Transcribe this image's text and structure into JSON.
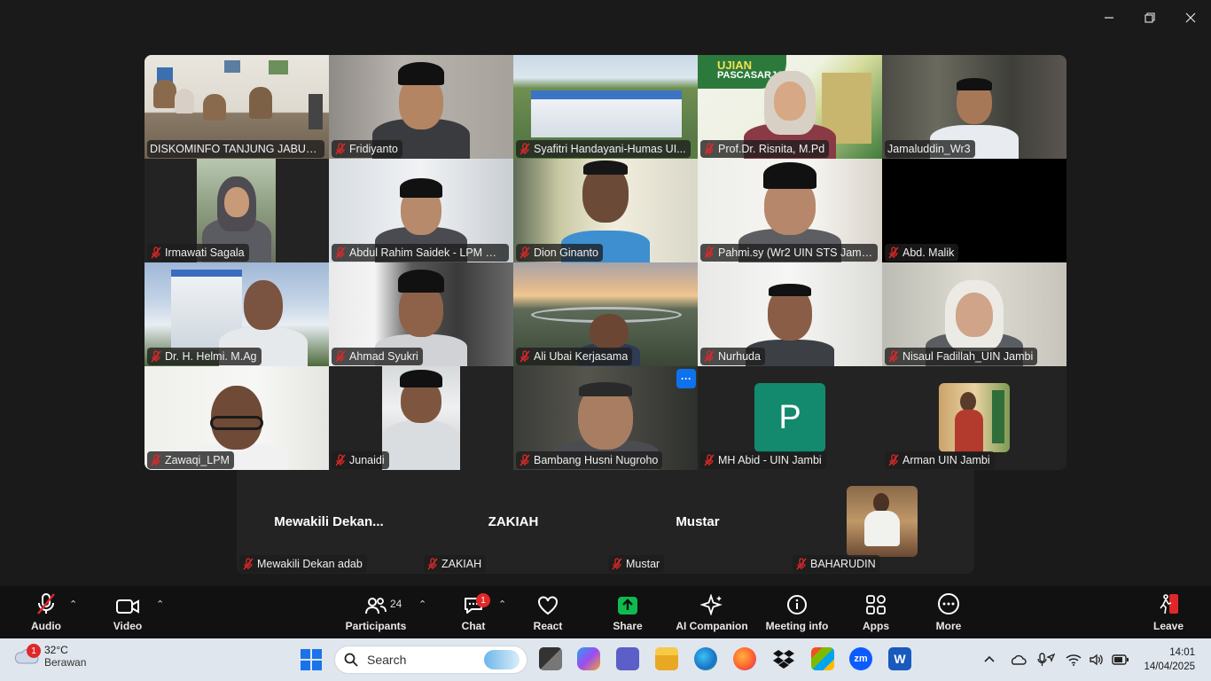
{
  "gallery": [
    {
      "name": "DISKOMINFO TANJUNG JABUNG...",
      "muted": false,
      "active": true
    },
    {
      "name": "Fridiyanto",
      "muted": true
    },
    {
      "name": "Syafitri Handayani-Humas UI...",
      "muted": true
    },
    {
      "name": "Prof.Dr. Risnita, M.Pd",
      "muted": true
    },
    {
      "name": "Jamaluddin_Wr3",
      "muted": false
    },
    {
      "name": "Irmawati Sagala",
      "muted": true
    },
    {
      "name": "Abdul  Rahim Saidek - LPM UI...",
      "muted": true
    },
    {
      "name": "Dion Ginanto",
      "muted": true
    },
    {
      "name": "Pahmi.sy (Wr2 UIN STS Jambi)",
      "muted": true
    },
    {
      "name": "Abd. Malik",
      "muted": true
    },
    {
      "name": "Dr. H. Helmi. M.Ag",
      "muted": true
    },
    {
      "name": "Ahmad Syukri",
      "muted": true
    },
    {
      "name": "Ali Ubai Kerjasama",
      "muted": true
    },
    {
      "name": "Nurhuda",
      "muted": true
    },
    {
      "name": "Nisaul Fadillah_UIN Jambi",
      "muted": true
    },
    {
      "name": "Zawaqi_LPM",
      "muted": true
    },
    {
      "name": "Junaidi",
      "muted": true
    },
    {
      "name": "Bambang Husni Nugroho",
      "muted": true
    },
    {
      "name": "MH Abid - UIN Jambi",
      "muted": true,
      "avatar_letter": "P"
    },
    {
      "name": "Arman UIN Jambi",
      "muted": true
    }
  ],
  "strip": [
    {
      "display": "Mewakili  Dekan...",
      "name": "Mewakili Dekan adab"
    },
    {
      "display": "ZAKIAH",
      "name": "ZAKIAH"
    },
    {
      "display": "Mustar",
      "name": "Mustar"
    },
    {
      "display": "",
      "name": "BAHARUDIN"
    }
  ],
  "more_badge": "···",
  "toolbar": {
    "audio": "Audio",
    "video": "Video",
    "participants": "Participants",
    "participants_count": "24",
    "chat": "Chat",
    "chat_badge": "1",
    "react": "React",
    "share": "Share",
    "ai_companion": "AI Companion",
    "meeting_info": "Meeting info",
    "apps": "Apps",
    "more": "More",
    "leave": "Leave"
  },
  "taskbar": {
    "weather_badge": "1",
    "temp": "32°C",
    "condition": "Berawan",
    "search_placeholder": "Search",
    "time": "14:01",
    "date": "14/04/2025"
  },
  "colors": {
    "accent_green": "#2ec866",
    "share_green": "#0dbb4f",
    "zoom_blue": "#0e72ed",
    "avatar_green": "#138a6e",
    "leave_red": "#e02828"
  }
}
